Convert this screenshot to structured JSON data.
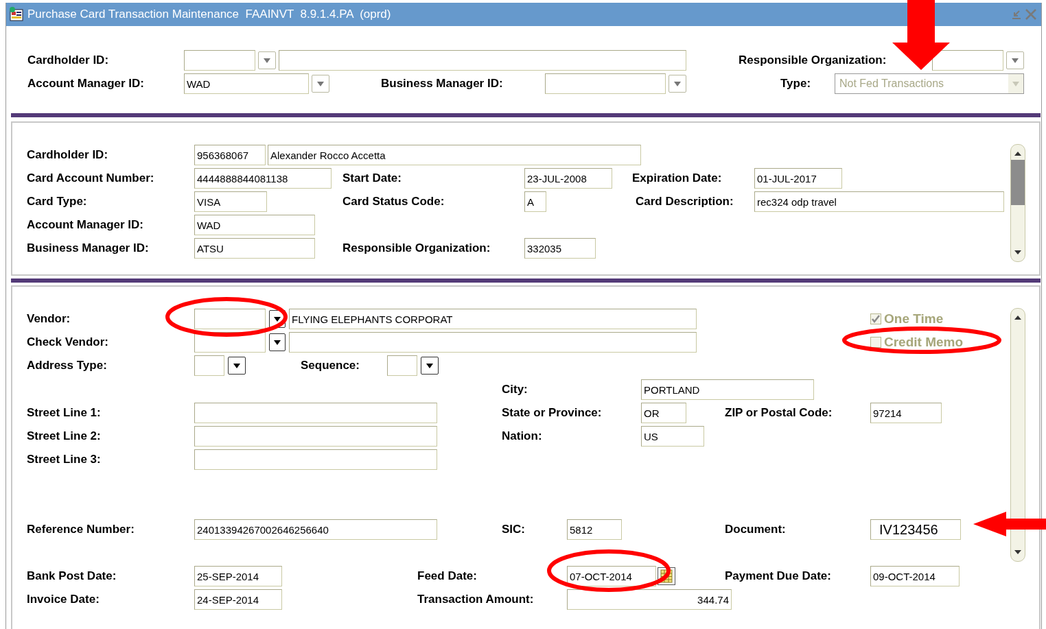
{
  "window": {
    "title": "Purchase Card Transaction Maintenance  FAAINVT  8.9.1.4.PA  (oprd)"
  },
  "key_block": {
    "rows": [
      {
        "items": [
          {
            "kind": "label",
            "text": "Cardholder ID:"
          },
          {
            "kind": "field"
          },
          {
            "kind": "dropdown"
          },
          {
            "kind": "field"
          },
          {
            "kind": "label",
            "text": "Responsible Organization:"
          },
          {
            "kind": "field"
          },
          {
            "kind": "dropdown"
          }
        ]
      },
      {
        "items": [
          {
            "kind": "label",
            "text": "Account Manager ID:"
          },
          {
            "kind": "field",
            "value": "WAD"
          },
          {
            "kind": "dropdown"
          },
          {
            "kind": "label",
            "text": "Business Manager ID:"
          },
          {
            "kind": "field"
          },
          {
            "kind": "dropdown"
          },
          {
            "kind": "label",
            "text": "Type:"
          },
          {
            "kind": "select",
            "value": "Not Fed Transactions",
            "disabled": true
          }
        ]
      }
    ]
  },
  "card_block": {
    "rows": [
      {
        "items": [
          {
            "kind": "label",
            "text": "Cardholder ID:"
          },
          {
            "kind": "field",
            "value": "956368067"
          },
          {
            "kind": "field",
            "value": "Alexander Rocco Accetta"
          }
        ]
      },
      {
        "items": [
          {
            "kind": "label",
            "text": "Card Account Number:"
          },
          {
            "kind": "field",
            "value": "4444888844081138"
          },
          {
            "kind": "label",
            "text": "Start Date:"
          },
          {
            "kind": "field",
            "value": "23-JUL-2008"
          },
          {
            "kind": "label",
            "text": "Expiration Date:"
          },
          {
            "kind": "field",
            "value": "01-JUL-2017"
          }
        ]
      },
      {
        "items": [
          {
            "kind": "label",
            "text": "Card Type:"
          },
          {
            "kind": "field",
            "value": "VISA"
          },
          {
            "kind": "label",
            "text": "Card Status Code:"
          },
          {
            "kind": "field",
            "value": "A"
          },
          {
            "kind": "label",
            "text": "Card Description:"
          },
          {
            "kind": "field",
            "value": "rec324 odp travel"
          }
        ]
      },
      {
        "items": [
          {
            "kind": "label",
            "text": "Account Manager ID:"
          },
          {
            "kind": "field",
            "value": "WAD"
          }
        ]
      },
      {
        "items": [
          {
            "kind": "label",
            "text": "Business Manager ID:"
          },
          {
            "kind": "field",
            "value": "ATSU"
          },
          {
            "kind": "label",
            "text": "Responsible Organization:"
          },
          {
            "kind": "field",
            "value": "332035"
          }
        ]
      }
    ]
  },
  "transaction_block": {
    "rows": [
      {
        "items": [
          {
            "kind": "label",
            "text": "Vendor:"
          },
          {
            "kind": "field"
          },
          {
            "kind": "dropdown"
          },
          {
            "kind": "field",
            "value": "FLYING ELEPHANTS CORPORAT"
          },
          {
            "kind": "checkbox",
            "text": "One Time",
            "checked": true,
            "disabled": true
          }
        ]
      },
      {
        "items": [
          {
            "kind": "label",
            "text": "Check Vendor:"
          },
          {
            "kind": "field"
          },
          {
            "kind": "dropdown"
          },
          {
            "kind": "field"
          },
          {
            "kind": "checkbox",
            "text": "Credit Memo",
            "checked": false,
            "disabled": true
          }
        ]
      },
      {
        "items": [
          {
            "kind": "label",
            "text": "Address Type:"
          },
          {
            "kind": "field"
          },
          {
            "kind": "dropdown"
          },
          {
            "kind": "label",
            "text": "Sequence:"
          },
          {
            "kind": "field"
          },
          {
            "kind": "dropdown"
          }
        ]
      },
      {
        "items": [
          {
            "kind": "label",
            "text": "City:"
          },
          {
            "kind": "field",
            "value": "PORTLAND"
          }
        ]
      },
      {
        "items": [
          {
            "kind": "label",
            "text": "Street Line 1:"
          },
          {
            "kind": "field"
          },
          {
            "kind": "label",
            "text": "State or Province:"
          },
          {
            "kind": "field",
            "value": "OR"
          },
          {
            "kind": "label",
            "text": "ZIP or Postal Code:"
          },
          {
            "kind": "field",
            "value": "97214"
          }
        ]
      },
      {
        "items": [
          {
            "kind": "label",
            "text": "Street Line 2:"
          },
          {
            "kind": "field"
          },
          {
            "kind": "label",
            "text": "Nation:"
          },
          {
            "kind": "field",
            "value": "US"
          }
        ]
      },
      {
        "items": [
          {
            "kind": "label",
            "text": "Street Line 3:"
          },
          {
            "kind": "field"
          }
        ]
      },
      {
        "items": [
          {
            "kind": "label",
            "text": "Reference Number:"
          },
          {
            "kind": "field",
            "value": "24013394267002646256640"
          },
          {
            "kind": "label",
            "text": "SIC:"
          },
          {
            "kind": "field",
            "value": "5812"
          },
          {
            "kind": "label",
            "text": "Document:"
          },
          {
            "kind": "field",
            "value": "IV123456"
          }
        ]
      },
      {
        "items": [
          {
            "kind": "label",
            "text": "Bank Post Date:"
          },
          {
            "kind": "field",
            "value": "25-SEP-2014"
          },
          {
            "kind": "label",
            "text": "Feed Date:"
          },
          {
            "kind": "field",
            "value": "07-OCT-2014"
          },
          {
            "kind": "calendar"
          },
          {
            "kind": "label",
            "text": "Payment Due Date:"
          },
          {
            "kind": "field",
            "value": "09-OCT-2014"
          }
        ]
      },
      {
        "items": [
          {
            "kind": "label",
            "text": "Invoice Date:"
          },
          {
            "kind": "field",
            "value": "24-SEP-2014"
          },
          {
            "kind": "label",
            "text": "Transaction Amount:"
          },
          {
            "kind": "field",
            "value": "344.74"
          }
        ]
      }
    ]
  }
}
